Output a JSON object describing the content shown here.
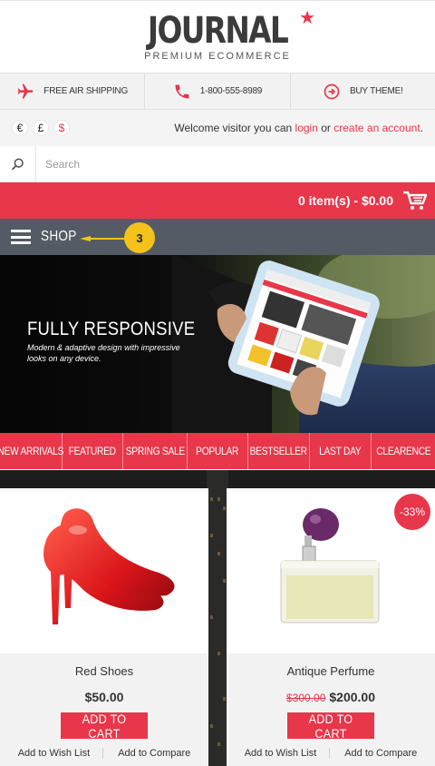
{
  "header": {
    "logo_title": "JOURNAL",
    "logo_subtitle": "PREMIUM ECOMMERCE"
  },
  "info_bar": {
    "items": [
      {
        "icon": "airplane-icon",
        "label": "FREE AIR SHIPPING"
      },
      {
        "icon": "phone-icon",
        "label": "1-800-555-8989"
      },
      {
        "icon": "arrow-circle-icon",
        "label": "BUY THEME!"
      }
    ]
  },
  "currencies": [
    "€",
    "£",
    "$"
  ],
  "welcome": {
    "prefix": "Welcome visitor you can",
    "login": "login",
    "or": "or",
    "create": "create an account",
    "suffix": "."
  },
  "search": {
    "placeholder": "Search"
  },
  "cart": {
    "summary": "0 item(s) - $0.00"
  },
  "menu": {
    "label": "SHOP",
    "callout": "3"
  },
  "hero": {
    "title": "FULLY RESPONSIVE",
    "subtitle": "Modern & adaptive design with impressive looks on any device."
  },
  "categories": [
    "NEW ARRIVALS",
    "FEATURED",
    "SPRING SALE",
    "POPULAR",
    "BESTSELLER",
    "LAST DAY",
    "CLEARENCE"
  ],
  "products": [
    {
      "name": "Red Shoes",
      "price": "$50.00",
      "old_price": "",
      "badge": "",
      "button": "ADD TO CART",
      "wishlist": "Add to Wish List",
      "compare": "Add to Compare"
    },
    {
      "name": "Antique Perfume",
      "price": "$200.00",
      "old_price": "$300.00",
      "badge": "-33%",
      "button": "ADD TO CART",
      "wishlist": "Add to Wish List",
      "compare": "Add to Compare"
    }
  ],
  "colors": {
    "accent": "#e8364a",
    "dark_bar": "#545b65",
    "callout": "#f5c21b"
  }
}
